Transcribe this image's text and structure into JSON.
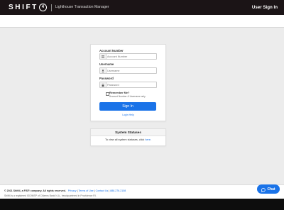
{
  "header": {
    "brand_word": "SHIFT",
    "brand_badge": "4",
    "product_name": "Lighthouse Transaction Manager",
    "user_signin": "User Sign In"
  },
  "login": {
    "account_label": "Account Number",
    "account_placeholder": "Account Number",
    "username_label": "Username",
    "username_placeholder": "Username",
    "password_label": "Password",
    "password_placeholder": "Password",
    "remember_label": "Remember Me?",
    "remember_hint": "Account Number & Username only",
    "signin_button": "Sign In",
    "login_help": "Login Help"
  },
  "status": {
    "title": "System Statuses",
    "body_prefix": "To view all system statuses, click ",
    "body_link": "here",
    "body_suffix": "."
  },
  "footer": {
    "copyright": "© 2021 Shift4, a FIS® company. All rights reserved.",
    "links": [
      "Privacy",
      "Terms of Use",
      "Contact Us",
      "888.276.2108"
    ],
    "registered_notice": "Shift4 is a registered ISO/MSP of Citizens Bank N.A., headquartered in Providence RI."
  },
  "chat": {
    "label": "Chat"
  },
  "colors": {
    "topbar": "#1b1416",
    "accent": "#1a73e8",
    "background": "#ececec",
    "bottombar": "#0d0d0d"
  },
  "icons": {
    "account": "list-icon",
    "username": "user-icon",
    "password": "lock-icon",
    "chat": "chat-bubble-icon"
  }
}
